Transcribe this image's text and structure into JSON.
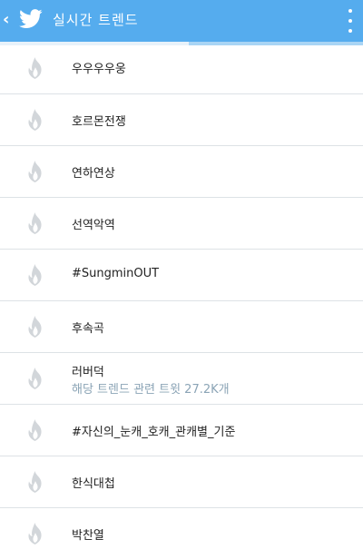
{
  "app": {
    "title": "실시간 트렌드",
    "back_icon": "chevron-left-icon",
    "logo_icon": "twitter-bird-icon",
    "menu_icon": "more-vertical-icon"
  },
  "colors": {
    "header": "#55acee",
    "accent_bar": "#a9d5f5",
    "flame": "#d2d6da",
    "subtext": "#8ba4b6",
    "divider": "#dde2e6"
  },
  "trends": [
    {
      "label": "우우우우웅",
      "icon": "flame-icon"
    },
    {
      "label": "호르몬전쟁",
      "icon": "flame-icon"
    },
    {
      "label": "연하연상",
      "icon": "flame-icon"
    },
    {
      "label": "선역악역",
      "icon": "flame-icon"
    },
    {
      "label": "#SungminOUT",
      "icon": "flame-icon"
    },
    {
      "label": "후속곡",
      "icon": "flame-icon"
    },
    {
      "label": "러버덕",
      "subtext": "해당 트렌드 관련 트윗 27.2K개",
      "icon": "flame-icon"
    },
    {
      "label": "#자신의_눈캐_호캐_관캐별_기준",
      "icon": "flame-icon"
    },
    {
      "label": "한식대첩",
      "icon": "flame-icon"
    },
    {
      "label": "박찬열",
      "icon": "flame-icon"
    }
  ]
}
